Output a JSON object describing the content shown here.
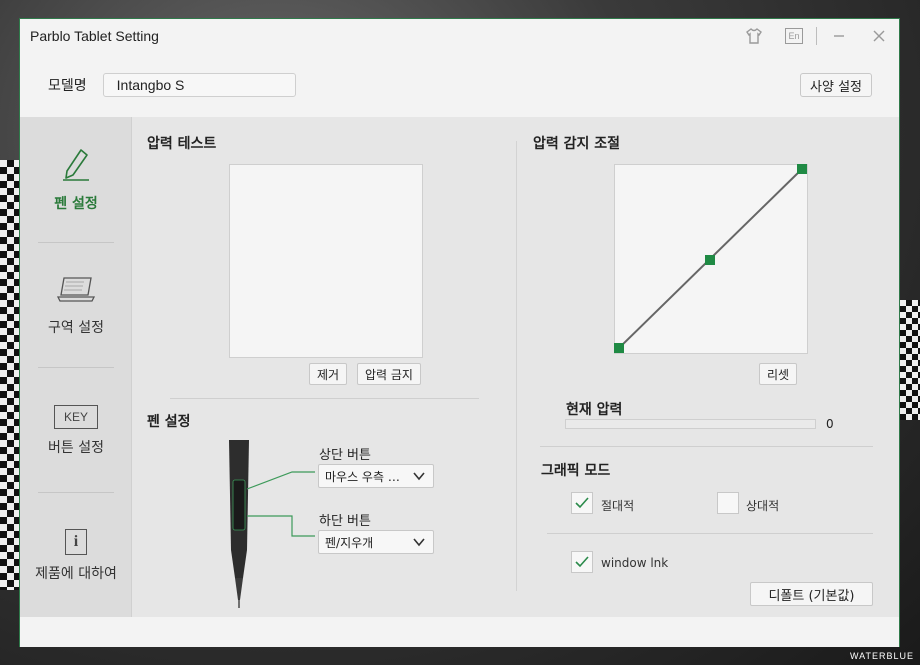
{
  "window": {
    "title": "Parblo Tablet Setting",
    "accent_color": "#2a8a4a",
    "titlebar_icons": [
      "shirt-icon",
      "language-icon",
      "minimize-icon",
      "close-icon"
    ],
    "language_code": "En"
  },
  "model": {
    "label": "모델명",
    "value": "Intangbo S",
    "spec_button": "사양 설정"
  },
  "sidebar": {
    "items": [
      {
        "label": "펜 설정",
        "icon": "pen-icon",
        "active": true
      },
      {
        "label": "구역 설정",
        "icon": "laptop-icon",
        "active": false
      },
      {
        "label": "버튼 설정",
        "icon": "key-icon",
        "icon_text": "KEY",
        "active": false
      },
      {
        "label": "제품에 대하여",
        "icon": "info-icon",
        "icon_text": "i",
        "active": false
      }
    ]
  },
  "pressure_test": {
    "title": "압력 테스트",
    "clear_button": "제거",
    "disable_button": "압력 금지"
  },
  "pen_settings": {
    "title": "펜 설정",
    "upper_button": {
      "label": "상단 버튼",
      "value": "마우스 우측 …"
    },
    "lower_button": {
      "label": "하단 버튼",
      "value": "펜/지우개"
    }
  },
  "pressure_sensitivity": {
    "title": "압력 감지 조절",
    "reset_button": "리셋",
    "current_pressure_label": "현재 압력",
    "current_pressure_value": "0",
    "current_pressure_fraction": 0
  },
  "graphic_mode": {
    "title": "그래픽 모드",
    "absolute": {
      "label": "절대적",
      "checked": true
    },
    "relative": {
      "label": "상대적",
      "checked": false
    },
    "windows_ink": {
      "label": "window lnk",
      "checked": true
    },
    "default_button": "디폴트 (기본값)"
  },
  "watermark": "WATERBLUE"
}
